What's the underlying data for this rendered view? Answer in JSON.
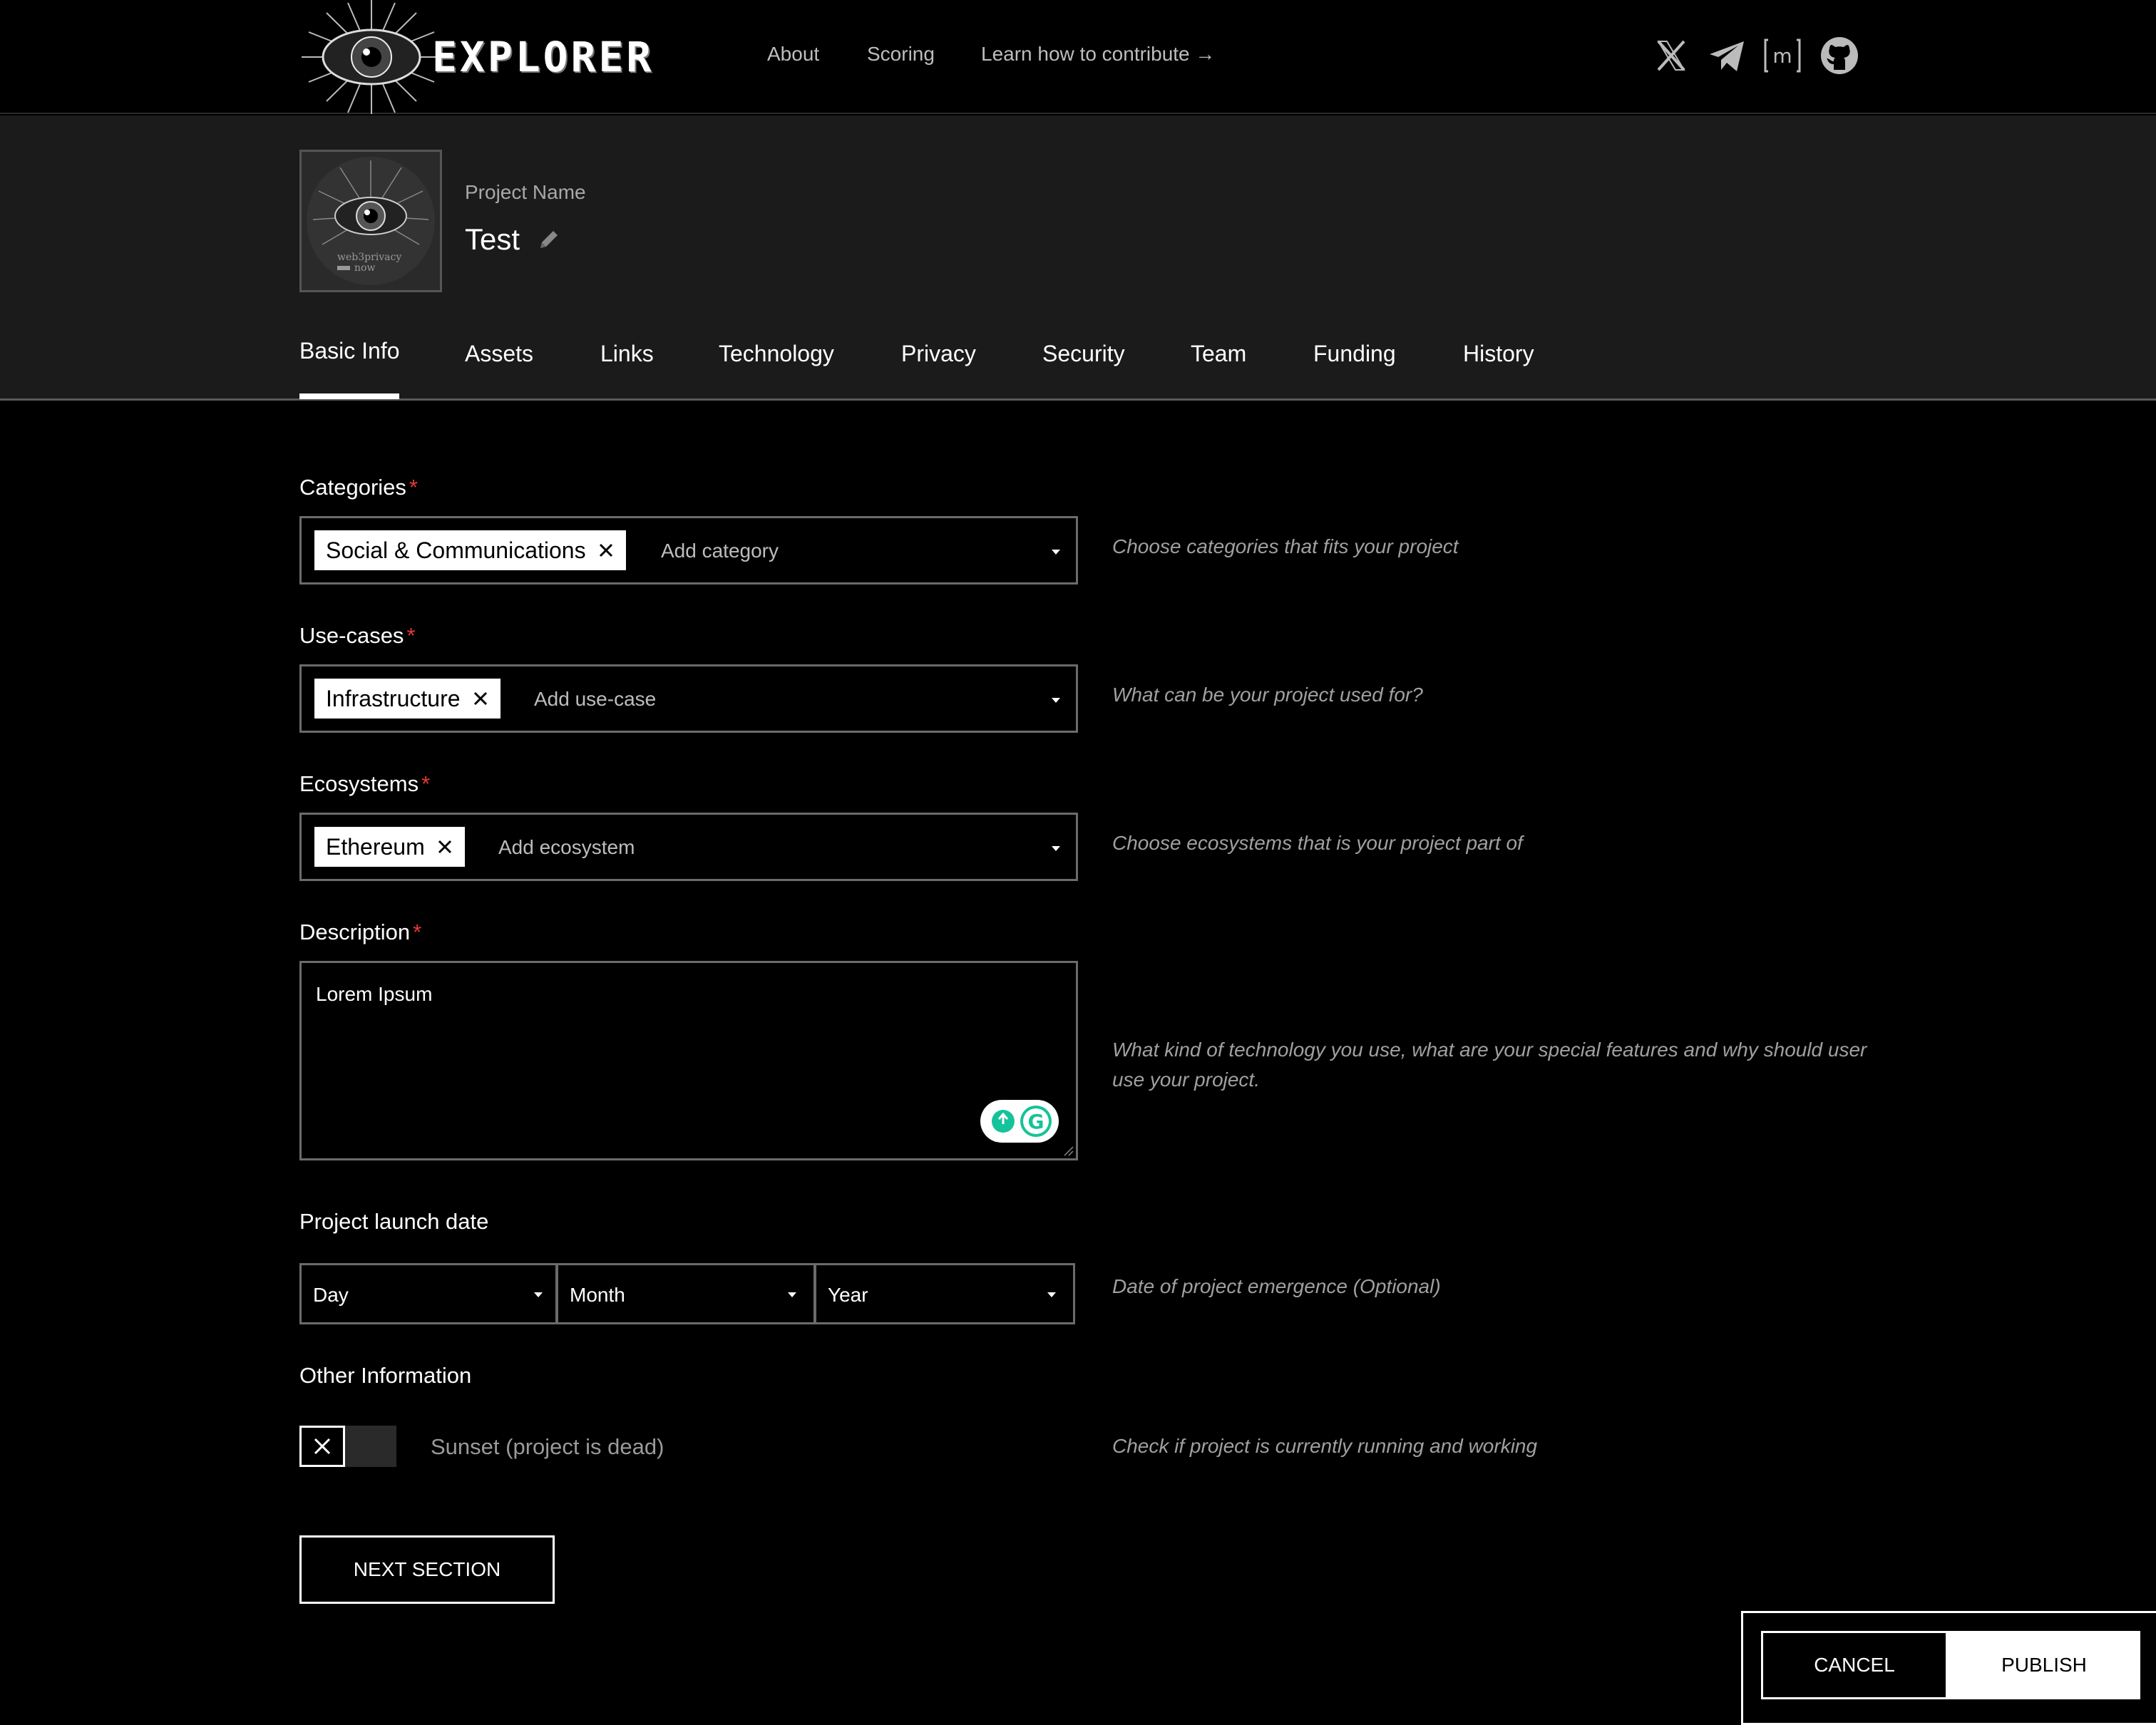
{
  "header": {
    "logo_text": "EXPLORER",
    "nav": {
      "about": "About",
      "scoring": "Scoring",
      "contribute": "Learn how to contribute →"
    },
    "social_icons": [
      "x-icon",
      "telegram-icon",
      "matrix-icon",
      "github-icon"
    ]
  },
  "project": {
    "name_label": "Project Name",
    "name": "Test",
    "avatar_text_1": "web3privacy",
    "avatar_text_2": "now"
  },
  "tabs": [
    "Basic Info",
    "Assets",
    "Links",
    "Technology",
    "Privacy",
    "Security",
    "Team",
    "Funding",
    "History"
  ],
  "active_tab": "Basic Info",
  "form": {
    "categories": {
      "label": "Categories",
      "required": "*",
      "chip": "Social & Communications",
      "placeholder": "Add category",
      "hint": "Choose categories that fits your project"
    },
    "usecases": {
      "label": "Use-cases",
      "required": "*",
      "chip": "Infrastructure",
      "placeholder": "Add use-case",
      "hint": "What can be your project used for?"
    },
    "ecosystems": {
      "label": "Ecosystems",
      "required": "*",
      "chip": "Ethereum",
      "placeholder": "Add ecosystem",
      "hint": "Choose ecosystems that is your project part of"
    },
    "description": {
      "label": "Description",
      "required": "*",
      "value": "Lorem Ipsum",
      "hint": "What kind of technology you use, what are your special features and why should user use your project."
    },
    "launch_date": {
      "label": "Project launch date",
      "day": "Day",
      "month": "Month",
      "year": "Year",
      "hint": "Date of project emergence (Optional)"
    },
    "other": {
      "label": "Other Information",
      "sunset_label": "Sunset (project is dead)",
      "sunset_checked": false,
      "hint": "Check if project is currently running and working"
    }
  },
  "buttons": {
    "next": "NEXT SECTION",
    "cancel": "CANCEL",
    "publish": "PUBLISH"
  },
  "colors": {
    "background": "#000000",
    "band": "#1b1b1b",
    "required": "#e53935",
    "grammarly": "#15c39a"
  }
}
